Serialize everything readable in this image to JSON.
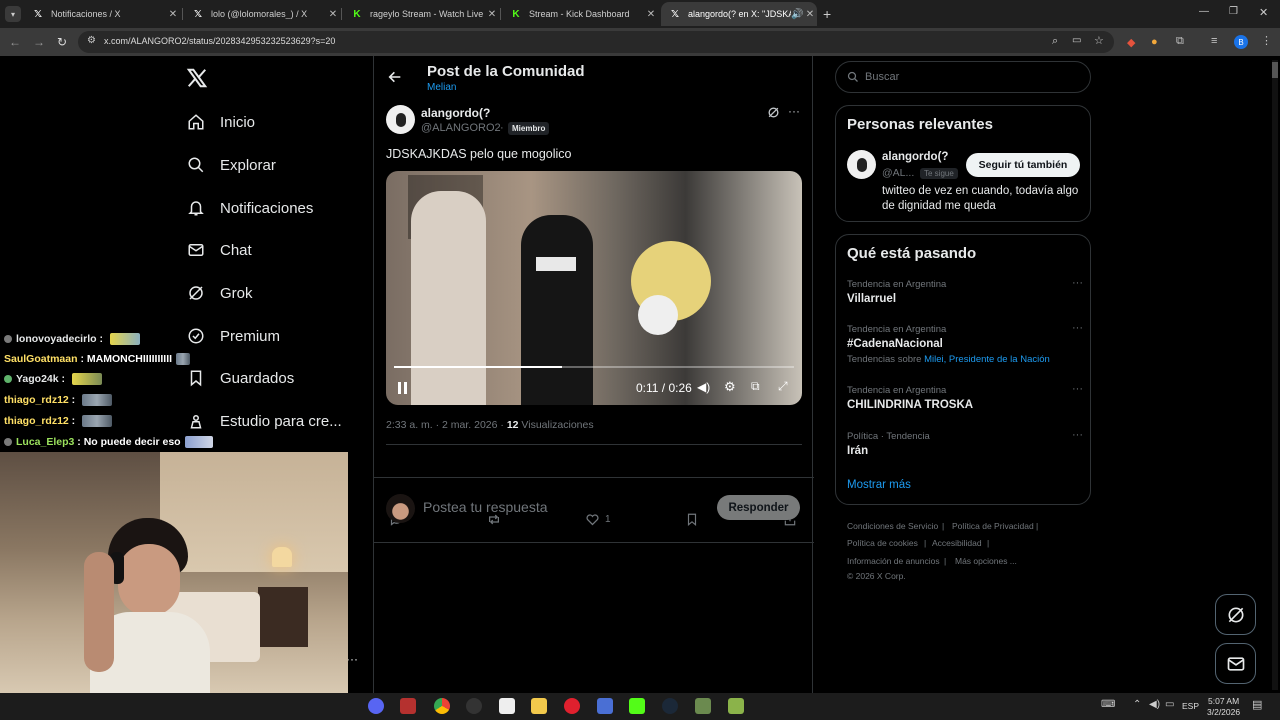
{
  "tabs": [
    {
      "title": "Notificaciones / X",
      "icon": "x-logo-icon",
      "active": false
    },
    {
      "title": "lolo (@lolomorales_) / X",
      "icon": "x-logo-icon",
      "active": false
    },
    {
      "title": "rageylo Stream - Watch Live on",
      "icon": "kick-logo-icon",
      "active": false
    },
    {
      "title": "Stream - Kick Dashboard",
      "icon": "kick-logo-icon",
      "active": false
    },
    {
      "title": "alangordo(? en X: \"JDSKAJK",
      "icon": "x-logo-icon",
      "active": true
    }
  ],
  "address_bar": {
    "url": "x.com/ALANGORO2/status/2028342953232523629?s=20"
  },
  "nav": {
    "items": [
      {
        "label": "Inicio",
        "icon": "home-icon"
      },
      {
        "label": "Explorar",
        "icon": "search-icon"
      },
      {
        "label": "Notificaciones",
        "icon": "bell-icon"
      },
      {
        "label": "Chat",
        "icon": "mail-icon"
      },
      {
        "label": "Grok",
        "icon": "grok-icon"
      },
      {
        "label": "Premium",
        "icon": "verified-icon"
      },
      {
        "label": "Guardados",
        "icon": "bookmark-icon"
      },
      {
        "label": "Estudio para cre...",
        "icon": "creator-studio-icon"
      }
    ]
  },
  "chat_overlay": {
    "lines": [
      {
        "user": "lonovoyadecirlo",
        "message": "",
        "color": "#e7e9ea"
      },
      {
        "user": "SaulGoatmaan",
        "message": "MAMONCHIIIIIIIIII",
        "color": "#ffe066"
      },
      {
        "user": "Yago24k",
        "message": "",
        "color": "#e7e9ea"
      },
      {
        "user": "thiago_rdz12",
        "message": "",
        "color": "#ffe066"
      },
      {
        "user": "thiago_rdz12",
        "message": "",
        "color": "#ffe066"
      },
      {
        "user": "Luca_Elep3",
        "message": "No puede decir eso",
        "color": "#9be15d"
      }
    ]
  },
  "header": {
    "title": "Post de la Comunidad",
    "community": "Melian"
  },
  "post": {
    "author_name": "alangordo(?",
    "author_handle": "@ALANGORO2",
    "role_badge": "Miembro",
    "text": "JDSKAJKDAS pelo que mogolico",
    "video": {
      "current_time": "0:11",
      "duration": "0:26",
      "progress": 0.42
    },
    "timestamp": "2:33 a. m. · 2 mar. 2026 · ",
    "views_count": "12",
    "views_label": "Visualizaciones",
    "likes": "1"
  },
  "reply": {
    "placeholder": "Postea tu respuesta",
    "button": "Responder"
  },
  "search": {
    "placeholder": "Buscar"
  },
  "relevant_people": {
    "title": "Personas relevantes",
    "name": "alangordo(?",
    "handle": "@AL...",
    "follows_you": "Te sigue",
    "follow_button": "Seguir tú también",
    "bio": "twitteo de vez en cuando, todavía algo de dignidad me queda"
  },
  "trends": {
    "title": "Qué está pasando",
    "items": [
      {
        "context": "Tendencia en Argentina",
        "name": "Villarruel",
        "extra_prefix": "",
        "extra_links": ""
      },
      {
        "context": "Tendencia en Argentina",
        "name": "#CadenaNacional",
        "extra_prefix": "Tendencias sobre",
        "extra_links": "Milei, Presidente de la Nación"
      },
      {
        "context": "Tendencia en Argentina",
        "name": "CHILINDRINA TROSKA",
        "extra_prefix": "",
        "extra_links": ""
      },
      {
        "context": "Política · Tendencia",
        "name": "Irán",
        "extra_prefix": "",
        "extra_links": ""
      }
    ],
    "show_more": "Mostrar más"
  },
  "footer": {
    "links": [
      "Condiciones de Servicio",
      "Política de Privacidad",
      "Política de cookies",
      "Accesibilidad",
      "Información de anuncios",
      "Más opciones ..."
    ],
    "copyright": "© 2026 X Corp."
  },
  "taskbar": {
    "lang": "ESP",
    "time": "5:07 AM",
    "date": "3/2/2026"
  },
  "colors": {
    "accent": "#1d9bf0",
    "background": "#000000",
    "border": "#2f3336",
    "muted": "#71767b"
  }
}
